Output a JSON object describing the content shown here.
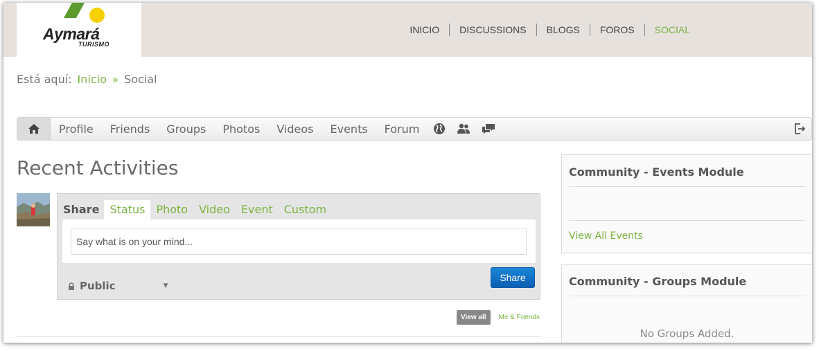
{
  "brand": {
    "name": "Aymará",
    "sub": "TURISMO"
  },
  "topnav": {
    "items": [
      "INICIO",
      "DISCUSSIONS",
      "BLOGS",
      "FOROS",
      "SOCIAL"
    ],
    "active": "SOCIAL"
  },
  "breadcrumb": {
    "prefix": "Está aquí:",
    "home": "Inicio",
    "separator": "»",
    "current": "Social"
  },
  "toolbar": {
    "items": [
      "Profile",
      "Friends",
      "Groups",
      "Photos",
      "Videos",
      "Events",
      "Forum"
    ],
    "icons": [
      "home-icon",
      "globe-icon",
      "users-icon",
      "chat-icon",
      "logout-icon"
    ]
  },
  "main": {
    "title": "Recent Activities"
  },
  "share": {
    "label": "Share",
    "tabs": [
      "Status",
      "Photo",
      "Video",
      "Event",
      "Custom"
    ],
    "active_tab": "Status",
    "placeholder": "Say what is on your mind...",
    "privacy": "Public",
    "button": "Share"
  },
  "filter": {
    "view_all": "View all",
    "me_friends": "Me & Friends"
  },
  "modules": {
    "events": {
      "title": "Community - Events Module",
      "link": "View All Events"
    },
    "groups": {
      "title": "Community - Groups Module",
      "empty": "No Groups Added."
    }
  },
  "colors": {
    "accent": "#7cb342",
    "button": "#0b5fb4",
    "topbar": "#e6e1dd"
  }
}
